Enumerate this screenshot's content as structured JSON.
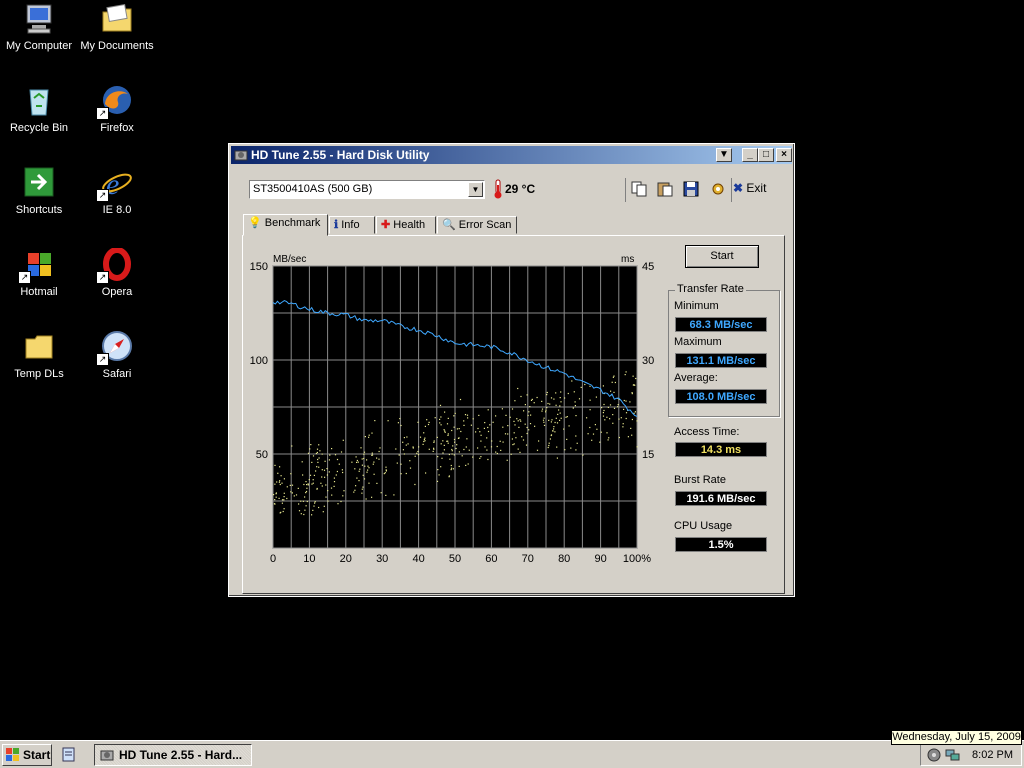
{
  "desktop": {
    "icons": [
      {
        "label": "My Computer",
        "icon": "computer-icon"
      },
      {
        "label": "My Documents",
        "icon": "folder-icon"
      },
      {
        "label": "Recycle Bin",
        "icon": "recycle-bin-icon"
      },
      {
        "label": "Firefox",
        "icon": "firefox-icon"
      },
      {
        "label": "Shortcuts",
        "icon": "shortcut-icon"
      },
      {
        "label": "IE 8.0",
        "icon": "ie-icon"
      },
      {
        "label": "Hotmail",
        "icon": "windows-logo-icon"
      },
      {
        "label": "Opera",
        "icon": "opera-icon"
      },
      {
        "label": "Temp DLs",
        "icon": "folder-icon"
      },
      {
        "label": "Safari",
        "icon": "safari-icon"
      }
    ]
  },
  "window": {
    "title": "HD Tune 2.55 - Hard Disk Utility",
    "drive": "ST3500410AS (500 GB)",
    "temperature": "29 °C",
    "exit_label": "Exit",
    "tabs": [
      {
        "label": "Benchmark",
        "icon": "lightbulb-icon"
      },
      {
        "label": "Info",
        "icon": "info-icon"
      },
      {
        "label": "Health",
        "icon": "health-cross-icon"
      },
      {
        "label": "Error Scan",
        "icon": "magnifier-icon"
      }
    ],
    "start_label": "Start",
    "transfer_rate": {
      "title": "Transfer Rate",
      "minimum_label": "Minimum",
      "minimum": "68.3 MB/sec",
      "maximum_label": "Maximum",
      "maximum": "131.1 MB/sec",
      "average_label": "Average:",
      "average": "108.0 MB/sec"
    },
    "access_time_label": "Access Time:",
    "access_time": "14.3 ms",
    "burst_rate_label": "Burst Rate",
    "burst_rate": "191.6 MB/sec",
    "cpu_usage_label": "CPU Usage",
    "cpu_usage": "1.5%",
    "colors": {
      "transfer": "#3fa8ff",
      "access": "#e8e890",
      "grid": "#8a8a8a"
    }
  },
  "chart_data": {
    "type": "line",
    "left_unit": "MB/sec",
    "right_unit": "ms",
    "ylim": [
      0,
      150
    ],
    "y2lim": [
      0,
      45
    ],
    "xlim": [
      0,
      100
    ],
    "left_ticks": [
      "150",
      "100",
      "50"
    ],
    "right_ticks": [
      "45",
      "30",
      "15"
    ],
    "x_ticks": [
      "0",
      "10",
      "20",
      "30",
      "40",
      "50",
      "60",
      "70",
      "80",
      "90",
      "100%"
    ],
    "series": [
      {
        "x": [
          0,
          5,
          10,
          15,
          20,
          25,
          30,
          35,
          40,
          45,
          50,
          55,
          60,
          65,
          70,
          75,
          80,
          85,
          90,
          95,
          100
        ],
        "values": [
          131,
          130,
          127,
          125,
          124,
          121,
          121,
          118,
          116,
          113,
          109,
          108,
          107,
          104,
          100,
          96,
          93,
          88,
          84,
          79,
          70
        ]
      }
    ],
    "scatter_trend_ms": {
      "x": [
        0,
        20,
        40,
        60,
        80,
        100
      ],
      "y": [
        9,
        13,
        16,
        19,
        21,
        23
      ]
    }
  },
  "taskbar": {
    "start_label": "Start",
    "task_label": "HD Tune 2.55 - Hard...",
    "clock": "8:02 PM",
    "tooltip": "Wednesday, July 15, 2009"
  }
}
